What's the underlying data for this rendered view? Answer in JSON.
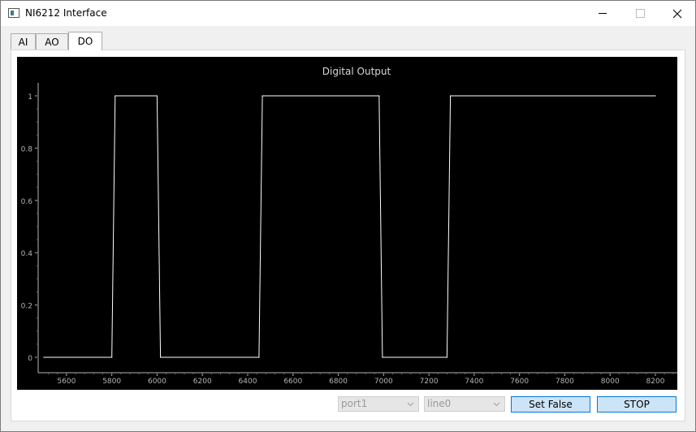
{
  "window": {
    "title": "NI6212 Interface"
  },
  "tabs": [
    {
      "label": "AI"
    },
    {
      "label": "AO"
    },
    {
      "label": "DO"
    }
  ],
  "active_tab": "DO",
  "controls": {
    "port_select": "port1",
    "line_select": "line0",
    "set_false_label": "Set False",
    "stop_label": "STOP"
  },
  "colors": {
    "plot_background": "#000000",
    "trace": "#ffffff",
    "button_fill": "#cce4f7",
    "button_border": "#0078d7"
  },
  "chart_data": {
    "type": "line",
    "title": "Digital Output",
    "xlabel": "",
    "ylabel": "",
    "xlim": [
      5500,
      8200
    ],
    "ylim": [
      0,
      1
    ],
    "x_ticks": [
      5600,
      5800,
      6000,
      6200,
      6400,
      6600,
      6800,
      7000,
      7200,
      7400,
      7600,
      7800,
      8000,
      8200
    ],
    "y_ticks": [
      0,
      0.2,
      0.4,
      0.6,
      0.8,
      1
    ],
    "y_tick_labels": [
      "0",
      "0.2",
      "0.4",
      "0.6",
      "0.8",
      "1"
    ],
    "grid": false,
    "series": [
      {
        "x": [
          5500,
          5800,
          5815,
          6000,
          6015,
          6450,
          6465,
          6980,
          6995,
          7280,
          7295,
          8200
        ],
        "y": [
          0,
          0,
          1,
          1,
          0,
          0,
          1,
          1,
          0,
          0,
          1,
          1
        ]
      }
    ]
  }
}
